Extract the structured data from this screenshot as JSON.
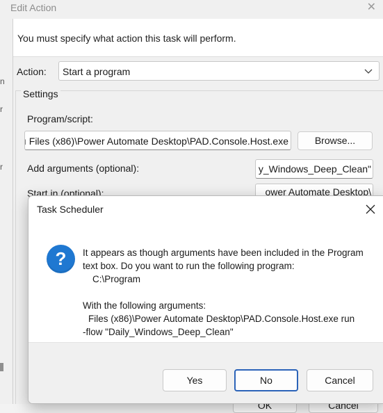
{
  "edit_action": {
    "title": "Edit Action",
    "close_glyph": "✕",
    "instruction": "You must specify what action this task will perform.",
    "action_label": "Action:",
    "action_value": "Start a program",
    "settings_label": "Settings",
    "program_label": "Program/script:",
    "program_value": "ı Files (x86)\\Power Automate Desktop\\PAD.Console.Host.exe",
    "browse_label": "Browse...",
    "arguments_label": "Add arguments (optional):",
    "arguments_value": "y_Windows_Deep_Clean\"",
    "start_in_label": "Start in (optional):",
    "start_in_value": "ower Automate Desktop\\",
    "ok_label": "OK",
    "cancel_label": "Cancel"
  },
  "modal": {
    "title": "Task Scheduler",
    "close_glyph": "✕",
    "icon_glyph": "?",
    "message_lines": [
      "It appears as though arguments have been included in the Program",
      "text box. Do you want to run the following program:",
      "C:\\Program",
      "",
      "With the following arguments:",
      "Files (x86)\\Power Automate Desktop\\PAD.Console.Host.exe run",
      "-flow \"Daily_Windows_Deep_Clean\""
    ],
    "buttons": {
      "yes": "Yes",
      "no": "No",
      "cancel": "Cancel"
    }
  },
  "left_edge_marks": [
    "n",
    "r",
    "r"
  ],
  "icons": {
    "dialog_icon": "question-icon",
    "dropdown_icon": "chevron-down-icon"
  },
  "colors": {
    "accent": "#2b63b8",
    "question_icon": "#1f78d1"
  }
}
